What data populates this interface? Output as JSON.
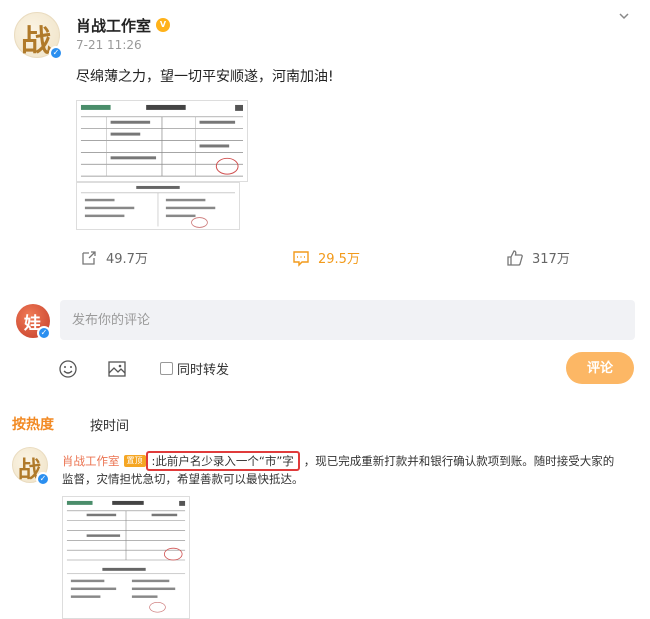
{
  "post": {
    "author": "肖战工作室",
    "time": "7-21 11:26",
    "text": "尽绵薄之力，望一切平安顺遂，河南加油!"
  },
  "actions": {
    "repost_count": "49.7万",
    "comment_count": "29.5万",
    "like_count": "317万"
  },
  "composer": {
    "placeholder": "发布你的评论",
    "repost_label": "同时转发",
    "submit_label": "评论"
  },
  "sort": {
    "hot": "按热度",
    "time": "按时间"
  },
  "comment": {
    "author": "肖战工作室",
    "badge": "置顶",
    "highlighted_text": ":此前户名少录入一个“市”字",
    "text_rest": "，现已完成重新打款并和银行确认款项到账。随时接受大家的",
    "text_line2": "监督，灾情担忧急切，希望善款可以最快抵达。"
  },
  "colors": {
    "accent_orange": "#f28a24",
    "highlight_red": "#e03b3b",
    "submit_bg": "#fcb765",
    "verified_blue": "#2b8ff0"
  }
}
